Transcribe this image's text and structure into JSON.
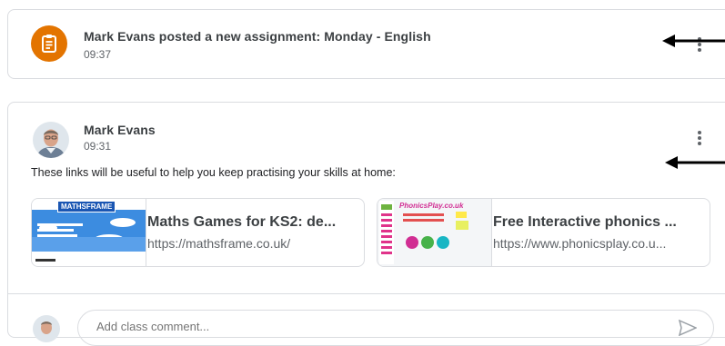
{
  "assignment": {
    "title": "Mark Evans posted a new assignment: Monday - English",
    "time": "09:37",
    "icon": "assignment-icon",
    "icon_color": "#e37400"
  },
  "post": {
    "author": "Mark Evans",
    "time": "09:31",
    "text": "These links will be useful to help you keep practising your skills at home:",
    "links": [
      {
        "title": "Maths Games for KS2: de...",
        "url": "https://mathsframe.co.uk/",
        "thumb_logo": "MATHSFRAME"
      },
      {
        "title": "Free Interactive phonics ...",
        "url": "https://www.phonicsplay.co.u...",
        "thumb_logo": "PhonicsPlay.co.uk"
      }
    ]
  },
  "comment": {
    "placeholder": "Add class comment..."
  }
}
